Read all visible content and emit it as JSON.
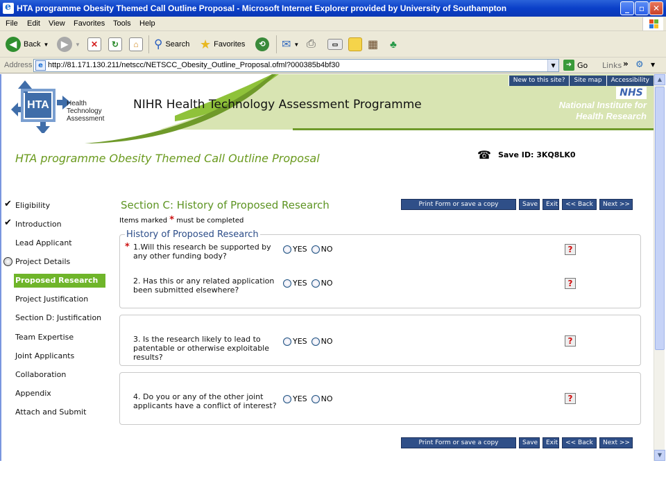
{
  "window": {
    "title": "HTA programme Obesity Themed Call Outline Proposal - Microsoft Internet Explorer provided by University of Southampton",
    "min": "_",
    "max": "▫",
    "close": "✕"
  },
  "menu": [
    "File",
    "Edit",
    "View",
    "Favorites",
    "Tools",
    "Help"
  ],
  "toolbar": {
    "back": "Back",
    "search": "Search",
    "favorites": "Favorites"
  },
  "address": {
    "label": "Address",
    "url": "http://81.171.130.211/netscc/NETSCC_Obesity_Outline_Proposal.ofml?000385b4bf30",
    "go": "Go",
    "links": "Links",
    "links_chev": "»"
  },
  "header": {
    "top_links": [
      "New to this site?",
      "Site map",
      "Accessibility"
    ],
    "logo_abbr": "HTA",
    "logo_lines": [
      "Health",
      "Technology",
      "Assessment"
    ],
    "title": "NIHR Health Technology Assessment Programme",
    "nhs": "NHS",
    "org_lines": [
      "National Institute for",
      "Health Research"
    ]
  },
  "form_title": "HTA programme Obesity Themed Call Outline Proposal",
  "save_id": "Save ID: 3KQ8LK0",
  "sidebar": {
    "items": [
      {
        "label": "Eligibility",
        "mark": "check"
      },
      {
        "label": "Introduction",
        "mark": "check"
      },
      {
        "label": "Lead Applicant",
        "mark": ""
      },
      {
        "label": "Project Details",
        "mark": "circle"
      },
      {
        "label": "Proposed Research",
        "mark": "active"
      },
      {
        "label": "Project Justification",
        "mark": ""
      },
      {
        "label": "Section D: Justification",
        "mark": ""
      },
      {
        "label": "Team Expertise",
        "mark": ""
      },
      {
        "label": "Joint Applicants",
        "mark": ""
      },
      {
        "label": "Collaboration",
        "mark": ""
      },
      {
        "label": "Appendix",
        "mark": ""
      },
      {
        "label": "Attach and Submit",
        "mark": ""
      }
    ]
  },
  "section": {
    "title": "Section C: History of Proposed Research",
    "items_marked_before": "Items marked",
    "star": "*",
    "items_marked_after": "must be completed",
    "legend": "History of Proposed Research"
  },
  "buttons": {
    "print": "Print Form or save a copy",
    "save": "Save",
    "exit": "Exit",
    "back": "<< Back",
    "next": "Next >>"
  },
  "questions": [
    {
      "text": "1.Will this research be supported by any other funding body?",
      "required": true
    },
    {
      "text": "2. Has this or any related application been submitted elsewhere?",
      "required": false
    },
    {
      "text": "3. Is the research likely to lead to patentable or otherwise exploitable results?",
      "required": false
    },
    {
      "text": "4. Do you or any of the other joint applicants have a conflict of interest?",
      "required": false
    }
  ],
  "radio_labels": {
    "yes": "YES",
    "no": "NO"
  },
  "help_glyph": "?"
}
